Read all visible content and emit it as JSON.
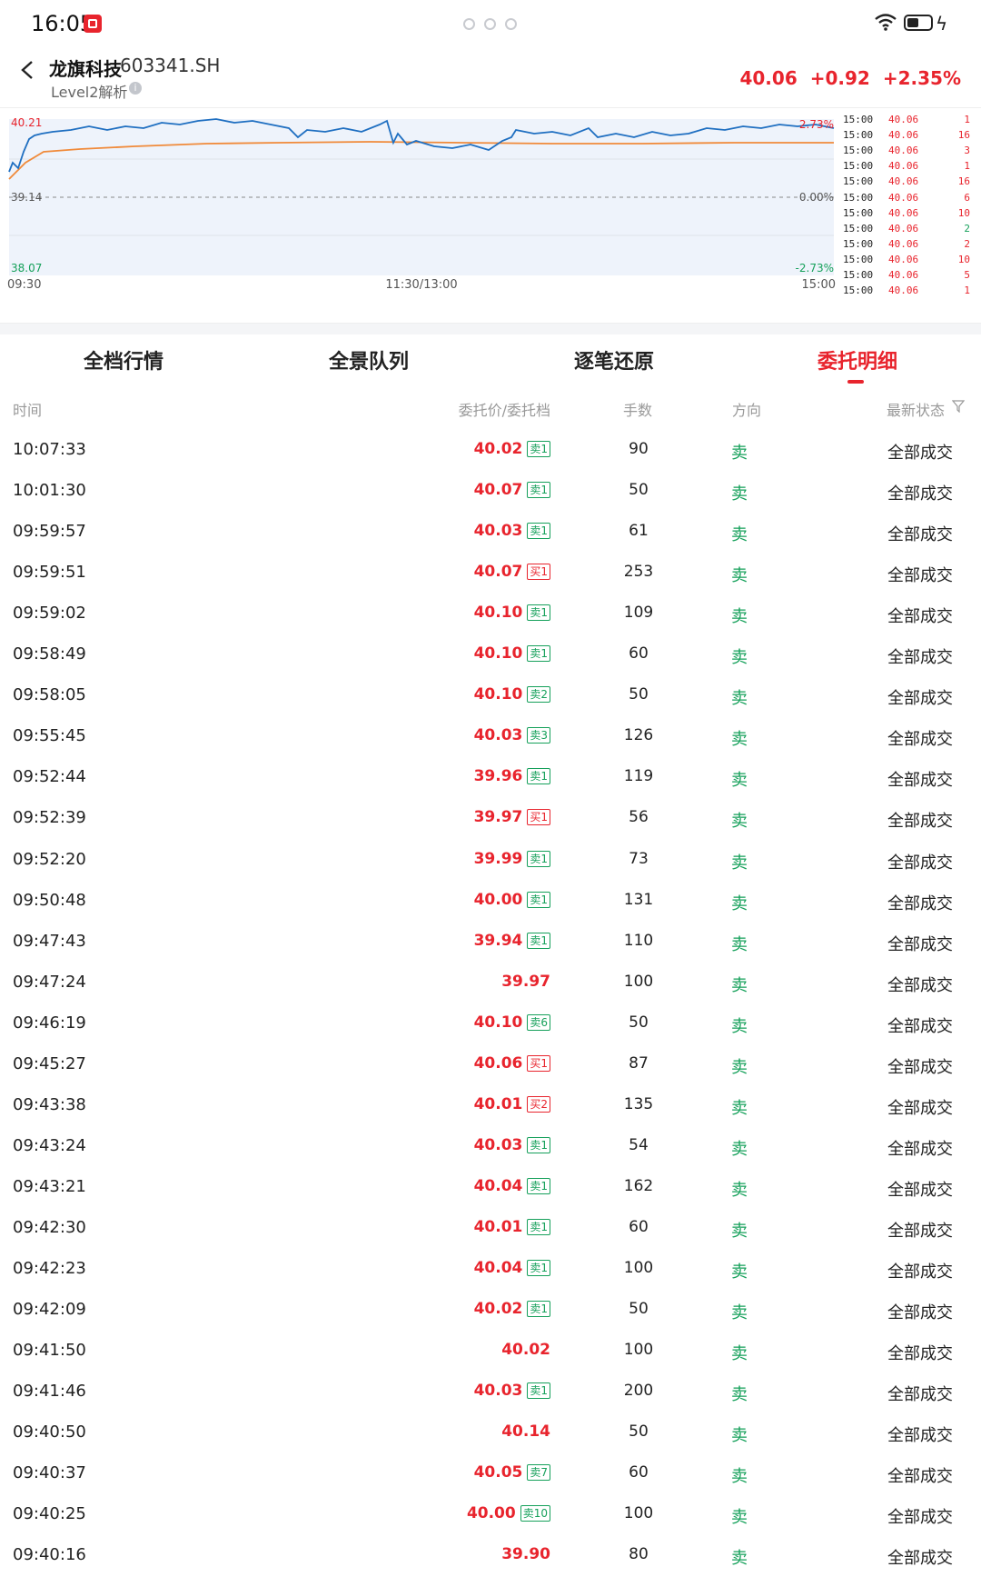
{
  "status_bar": {
    "time": "16:05"
  },
  "header": {
    "stock_name": "龙旗科技",
    "stock_code": "603341.SH",
    "subtitle": "Level2解析",
    "price": "40.06",
    "change": "+0.92",
    "change_pct": "+2.35%"
  },
  "chart": {
    "high_label": "40.21",
    "prev_label": "39.14",
    "low_label": "38.07",
    "pct_high": "2.73%",
    "pct_zero": "0.00%",
    "pct_low": "-2.73%",
    "time_start": "09:30",
    "time_mid": "11:30/13:00",
    "time_end": "15:00",
    "colors": {
      "price_line": "#1f6fc1",
      "avg_line": "#f08a3a",
      "area": "#eaf1fb"
    }
  },
  "tick_list": [
    {
      "time": "15:00",
      "price": "40.06",
      "vol": "1",
      "dir": "sell"
    },
    {
      "time": "15:00",
      "price": "40.06",
      "vol": "16",
      "dir": "sell"
    },
    {
      "time": "15:00",
      "price": "40.06",
      "vol": "3",
      "dir": "sell"
    },
    {
      "time": "15:00",
      "price": "40.06",
      "vol": "1",
      "dir": "sell"
    },
    {
      "time": "15:00",
      "price": "40.06",
      "vol": "16",
      "dir": "sell"
    },
    {
      "time": "15:00",
      "price": "40.06",
      "vol": "6",
      "dir": "sell"
    },
    {
      "time": "15:00",
      "price": "40.06",
      "vol": "10",
      "dir": "sell"
    },
    {
      "time": "15:00",
      "price": "40.06",
      "vol": "2",
      "dir": "buy"
    },
    {
      "time": "15:00",
      "price": "40.06",
      "vol": "2",
      "dir": "sell"
    },
    {
      "time": "15:00",
      "price": "40.06",
      "vol": "10",
      "dir": "sell"
    },
    {
      "time": "15:00",
      "price": "40.06",
      "vol": "5",
      "dir": "sell"
    },
    {
      "time": "15:00",
      "price": "40.06",
      "vol": "1",
      "dir": "sell"
    }
  ],
  "tabs": [
    "全档行情",
    "全景队列",
    "逐笔还原",
    "委托明细"
  ],
  "table": {
    "headers": {
      "time": "时间",
      "price": "委托价/委托档",
      "qty": "手数",
      "direction": "方向",
      "status": "最新状态"
    },
    "rows": [
      {
        "time": "10:07:33",
        "price": "40.02",
        "level": "卖1",
        "qty": "90",
        "dir": "卖",
        "status": "全部成交"
      },
      {
        "time": "10:01:30",
        "price": "40.07",
        "level": "卖1",
        "qty": "50",
        "dir": "卖",
        "status": "全部成交"
      },
      {
        "time": "09:59:57",
        "price": "40.03",
        "level": "卖1",
        "qty": "61",
        "dir": "卖",
        "status": "全部成交"
      },
      {
        "time": "09:59:51",
        "price": "40.07",
        "level": "买1",
        "qty": "253",
        "dir": "卖",
        "status": "全部成交"
      },
      {
        "time": "09:59:02",
        "price": "40.10",
        "level": "卖1",
        "qty": "109",
        "dir": "卖",
        "status": "全部成交"
      },
      {
        "time": "09:58:49",
        "price": "40.10",
        "level": "卖1",
        "qty": "60",
        "dir": "卖",
        "status": "全部成交"
      },
      {
        "time": "09:58:05",
        "price": "40.10",
        "level": "卖2",
        "qty": "50",
        "dir": "卖",
        "status": "全部成交"
      },
      {
        "time": "09:55:45",
        "price": "40.03",
        "level": "卖3",
        "qty": "126",
        "dir": "卖",
        "status": "全部成交"
      },
      {
        "time": "09:52:44",
        "price": "39.96",
        "level": "卖1",
        "qty": "119",
        "dir": "卖",
        "status": "全部成交"
      },
      {
        "time": "09:52:39",
        "price": "39.97",
        "level": "买1",
        "qty": "56",
        "dir": "卖",
        "status": "全部成交"
      },
      {
        "time": "09:52:20",
        "price": "39.99",
        "level": "卖1",
        "qty": "73",
        "dir": "卖",
        "status": "全部成交"
      },
      {
        "time": "09:50:48",
        "price": "40.00",
        "level": "卖1",
        "qty": "131",
        "dir": "卖",
        "status": "全部成交"
      },
      {
        "time": "09:47:43",
        "price": "39.94",
        "level": "卖1",
        "qty": "110",
        "dir": "卖",
        "status": "全部成交"
      },
      {
        "time": "09:47:24",
        "price": "39.97",
        "level": "",
        "qty": "100",
        "dir": "卖",
        "status": "全部成交"
      },
      {
        "time": "09:46:19",
        "price": "40.10",
        "level": "卖6",
        "qty": "50",
        "dir": "卖",
        "status": "全部成交"
      },
      {
        "time": "09:45:27",
        "price": "40.06",
        "level": "买1",
        "qty": "87",
        "dir": "卖",
        "status": "全部成交"
      },
      {
        "time": "09:43:38",
        "price": "40.01",
        "level": "买2",
        "qty": "135",
        "dir": "卖",
        "status": "全部成交"
      },
      {
        "time": "09:43:24",
        "price": "40.03",
        "level": "卖1",
        "qty": "54",
        "dir": "卖",
        "status": "全部成交"
      },
      {
        "time": "09:43:21",
        "price": "40.04",
        "level": "卖1",
        "qty": "162",
        "dir": "卖",
        "status": "全部成交"
      },
      {
        "time": "09:42:30",
        "price": "40.01",
        "level": "卖1",
        "qty": "60",
        "dir": "卖",
        "status": "全部成交"
      },
      {
        "time": "09:42:23",
        "price": "40.04",
        "level": "卖1",
        "qty": "100",
        "dir": "卖",
        "status": "全部成交"
      },
      {
        "time": "09:42:09",
        "price": "40.02",
        "level": "卖1",
        "qty": "50",
        "dir": "卖",
        "status": "全部成交"
      },
      {
        "time": "09:41:50",
        "price": "40.02",
        "level": "",
        "qty": "100",
        "dir": "卖",
        "status": "全部成交"
      },
      {
        "time": "09:41:46",
        "price": "40.03",
        "level": "卖1",
        "qty": "200",
        "dir": "卖",
        "status": "全部成交"
      },
      {
        "time": "09:40:50",
        "price": "40.14",
        "level": "",
        "qty": "50",
        "dir": "卖",
        "status": "全部成交"
      },
      {
        "time": "09:40:37",
        "price": "40.05",
        "level": "卖7",
        "qty": "60",
        "dir": "卖",
        "status": "全部成交"
      },
      {
        "time": "09:40:25",
        "price": "40.00",
        "level": "卖10",
        "qty": "100",
        "dir": "卖",
        "status": "全部成交"
      },
      {
        "time": "09:40:16",
        "price": "39.90",
        "level": "",
        "qty": "80",
        "dir": "卖",
        "status": "全部成交"
      }
    ]
  }
}
